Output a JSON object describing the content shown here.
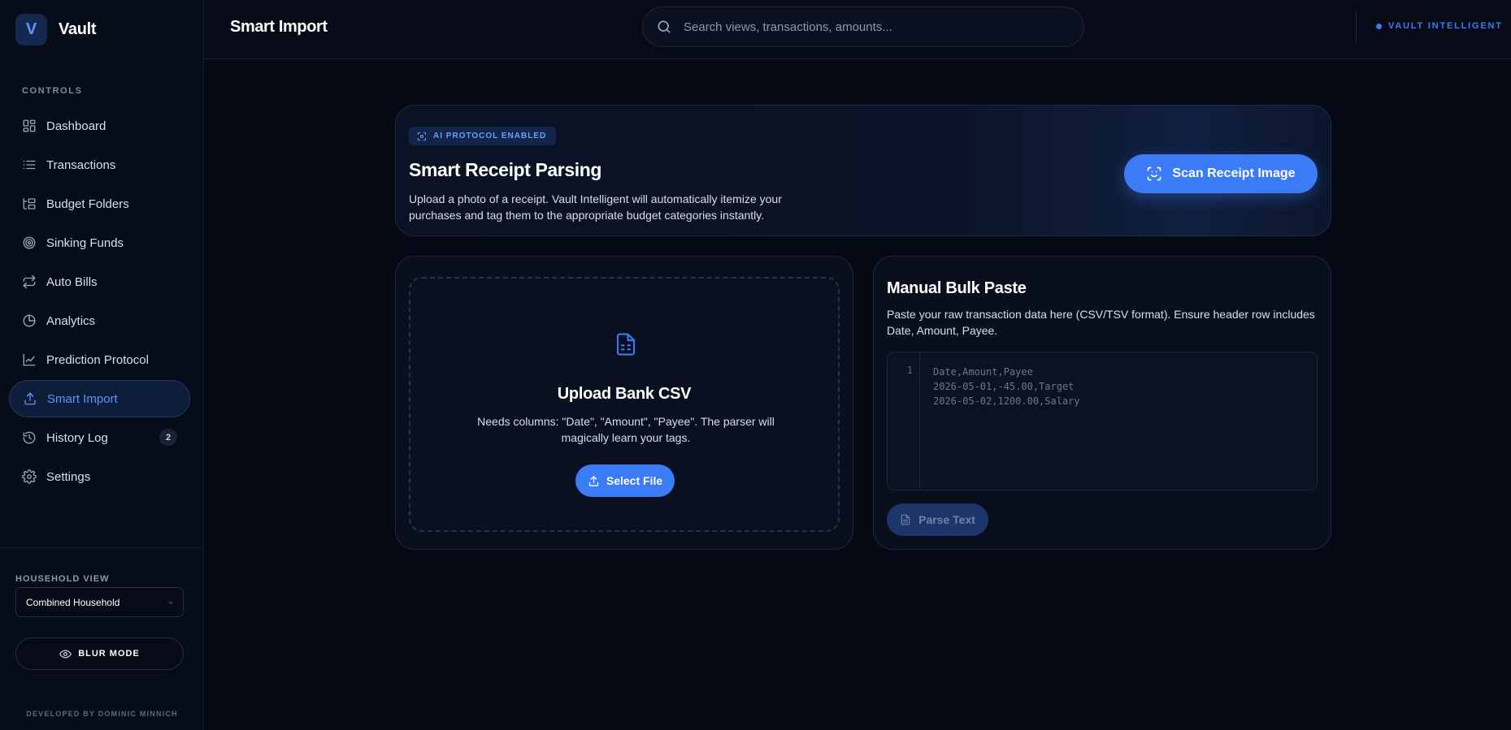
{
  "brand": {
    "logo_letter": "V",
    "name": "Vault"
  },
  "sidebar": {
    "section_label": "CONTROLS",
    "items": [
      {
        "label": "Dashboard",
        "icon": "dashboard-grid-icon",
        "active": false
      },
      {
        "label": "Transactions",
        "icon": "list-icon",
        "active": false
      },
      {
        "label": "Budget Folders",
        "icon": "folder-tree-icon",
        "active": false
      },
      {
        "label": "Sinking Funds",
        "icon": "target-icon",
        "active": false
      },
      {
        "label": "Auto Bills",
        "icon": "repeat-icon",
        "active": false
      },
      {
        "label": "Analytics",
        "icon": "pie-chart-icon",
        "active": false
      },
      {
        "label": "Prediction Protocol",
        "icon": "line-chart-icon",
        "active": false
      },
      {
        "label": "Smart Import",
        "icon": "upload-icon",
        "active": true
      },
      {
        "label": "History Log",
        "icon": "history-icon",
        "active": false,
        "badge": "2"
      },
      {
        "label": "Settings",
        "icon": "gear-icon",
        "active": false
      }
    ],
    "household_label": "HOUSEHOLD VIEW",
    "household_value": "Combined Household",
    "blur_mode_label": "BLUR MODE",
    "credit": "DEVELOPED BY DOMINIC MINNICH"
  },
  "header": {
    "title": "Smart Import",
    "search_placeholder": "Search views, transactions, amounts...",
    "status_label": "VAULT INTELLIGENT"
  },
  "hero": {
    "badge": "AI PROTOCOL ENABLED",
    "title": "Smart Receipt Parsing",
    "description": "Upload a photo of a receipt. Vault Intelligent will automatically itemize your purchases and tag them to the appropriate budget categories instantly.",
    "button_label": "Scan Receipt Image"
  },
  "upload": {
    "title": "Upload Bank CSV",
    "description": "Needs columns: \"Date\", \"Amount\", \"Payee\". The parser will magically learn your tags.",
    "button_label": "Select File"
  },
  "paste": {
    "title": "Manual Bulk Paste",
    "description": "Paste your raw transaction data here (CSV/TSV format). Ensure header row includes Date, Amount, Payee.",
    "line_number": "1",
    "placeholder_lines": [
      "Date,Amount,Payee",
      "2026-05-01,-45.00,Target",
      "2026-05-02,1200.00,Salary"
    ],
    "button_label": "Parse Text"
  },
  "colors": {
    "background": "#050914",
    "accent": "#3b7bf6",
    "card": "#0a0f1e"
  }
}
